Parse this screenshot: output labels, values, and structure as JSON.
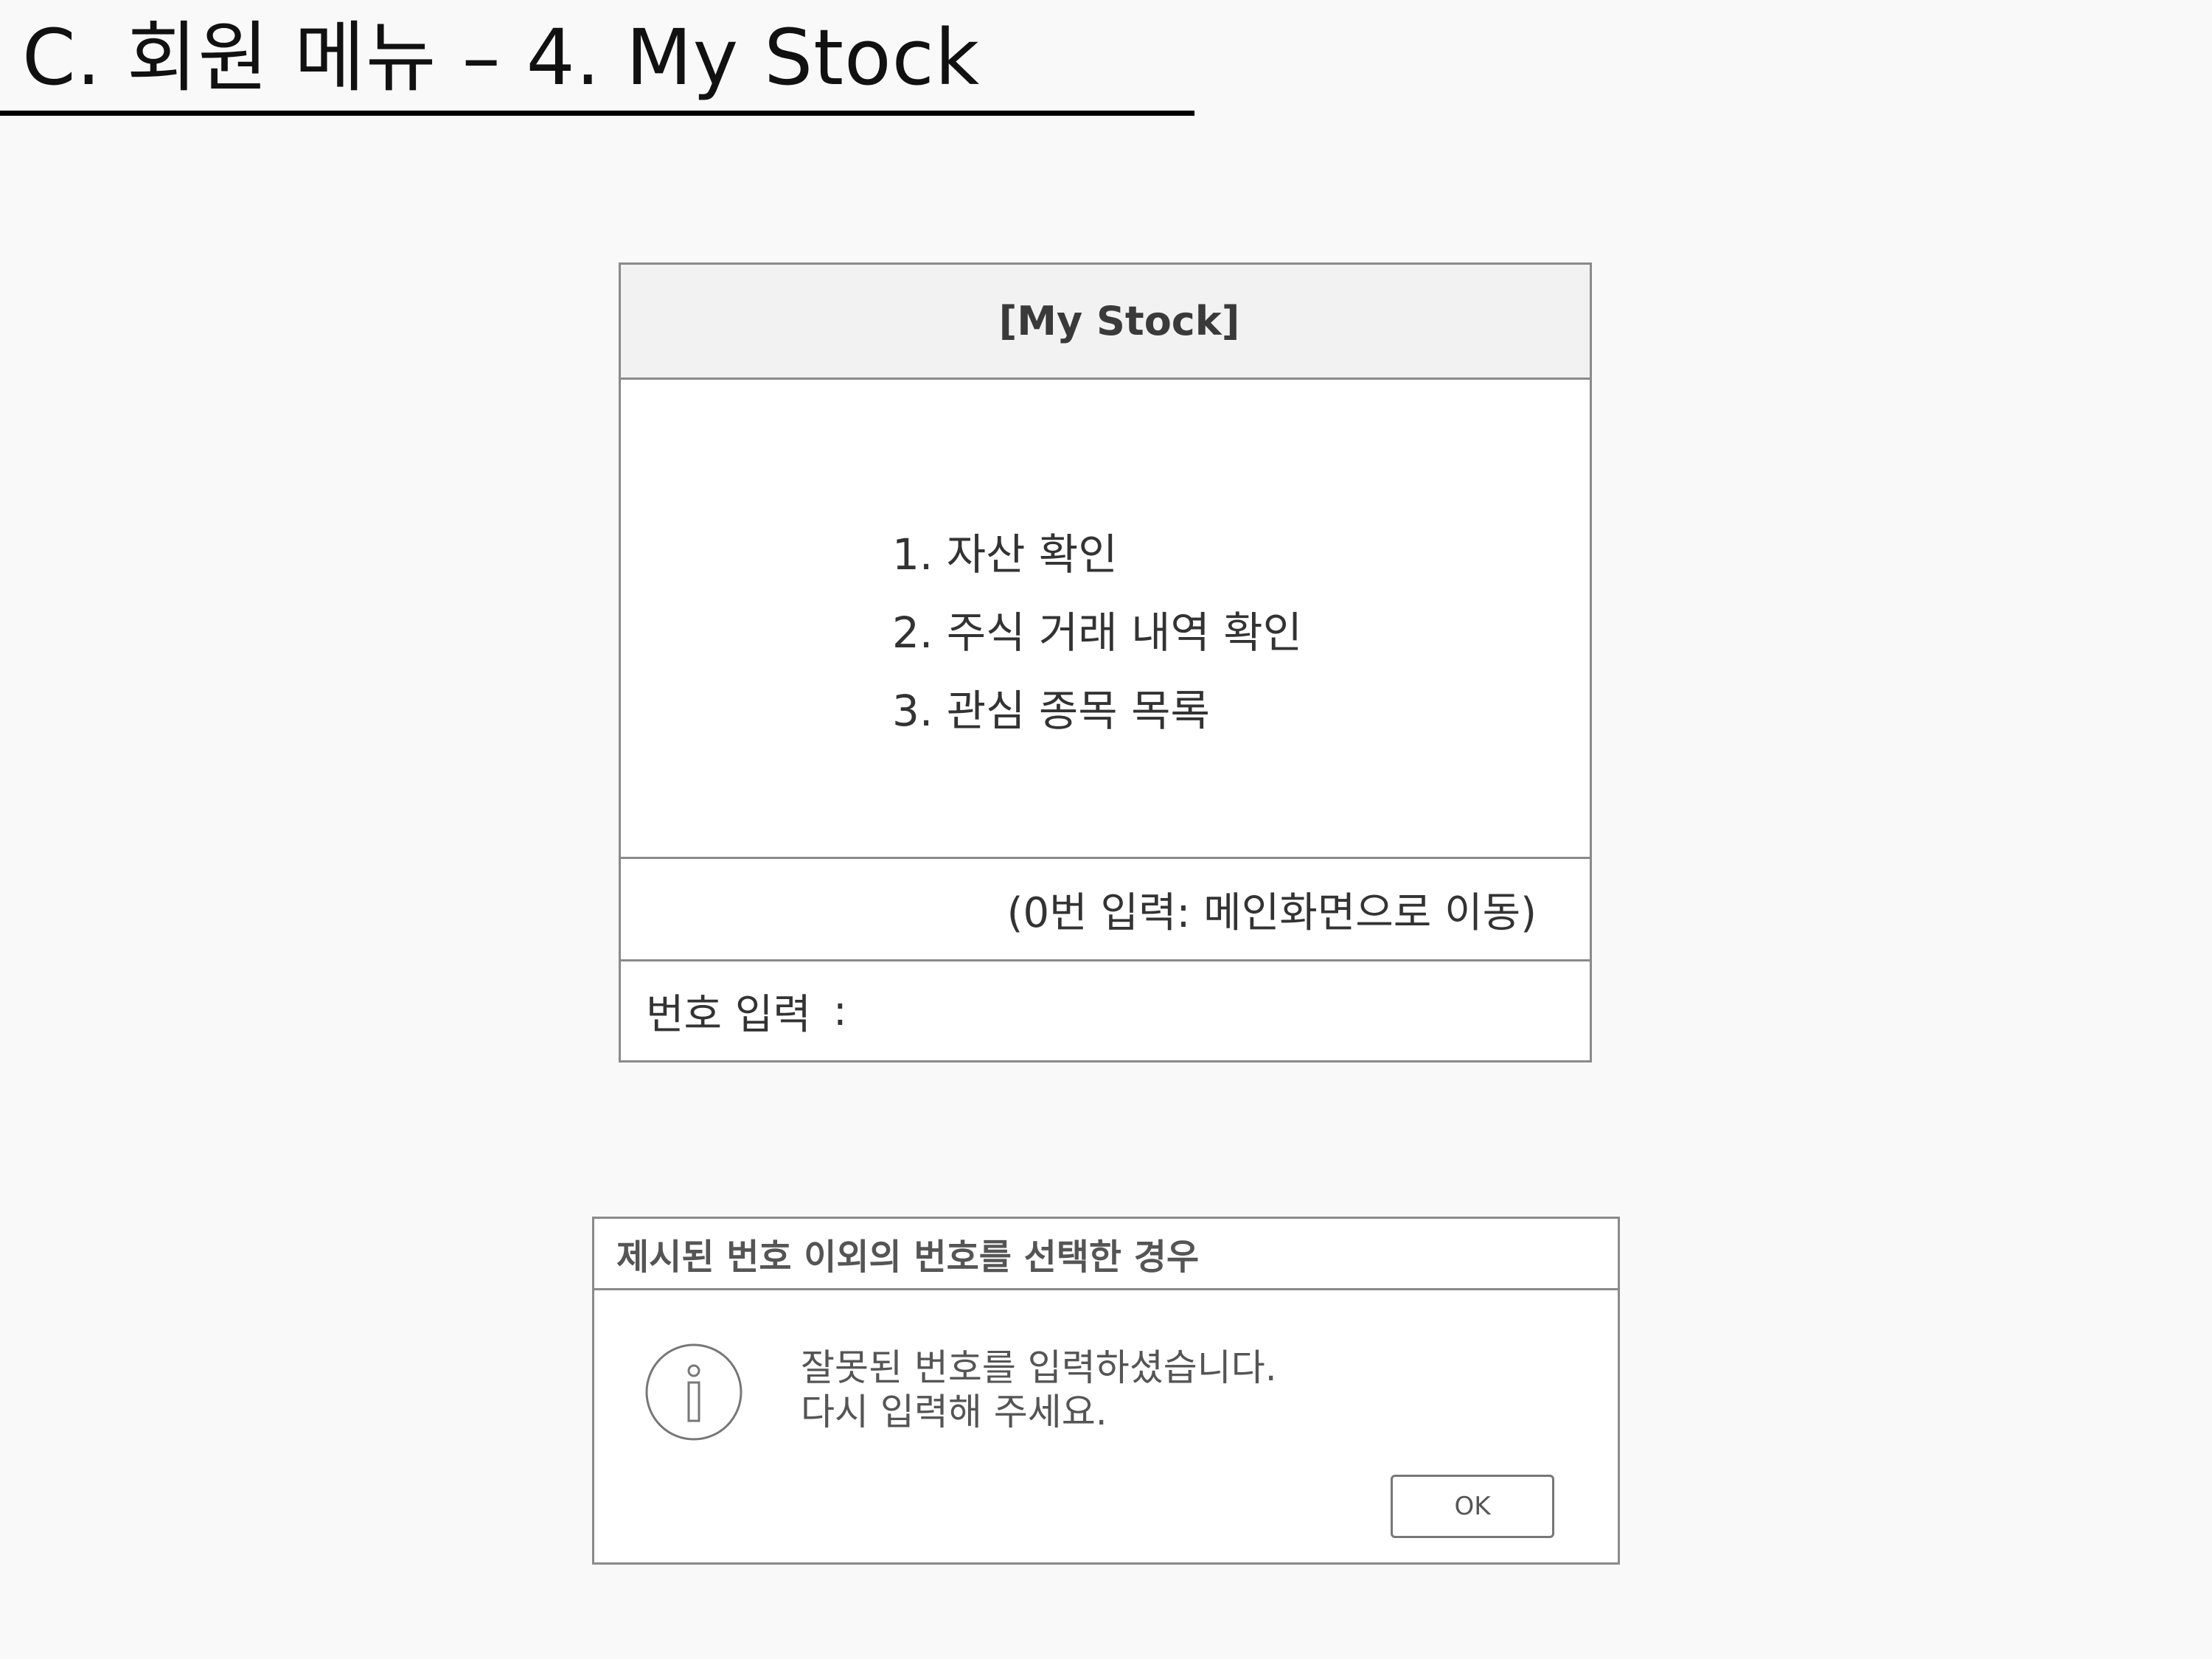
{
  "slide": {
    "title": "C. 회원 메뉴 – 4. My Stock"
  },
  "console": {
    "title": "[My Stock]",
    "menu_items": [
      "1. 자산 확인",
      "2. 주식 거래 내역 확인",
      "3. 관심 종목 목록"
    ],
    "hint": "(0번 입력: 메인화면으로 이동)",
    "input_label": "번호 입력",
    "input_colon": ":",
    "input_value": ""
  },
  "dialog": {
    "title": "제시된 번호 이외의 번호를 선택한 경우",
    "icon": "info-icon",
    "message_line1": "잘못된 번호를 입력하셨습니다.",
    "message_line2": "다시 입력해 주세요.",
    "ok_label": "OK"
  },
  "colors": {
    "background": "#f9f9f9",
    "border": "#8a8a8a",
    "header_fill": "#f2f2f2",
    "text": "#333333",
    "dialog_text": "#555555"
  }
}
